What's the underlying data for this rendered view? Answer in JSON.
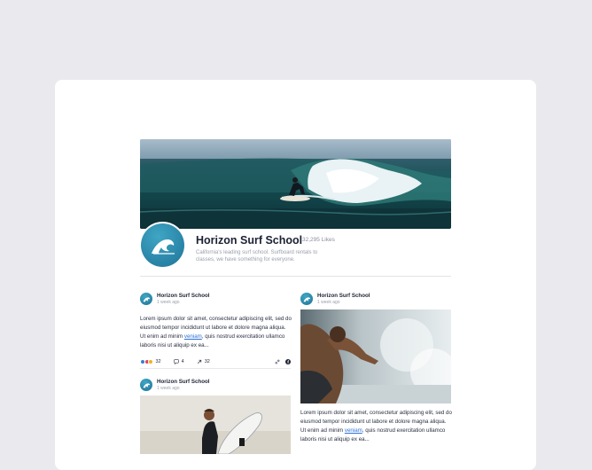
{
  "page": {
    "name": "Horizon Surf School",
    "likes": "32,295 Likes",
    "description": "California's leading surf school. Surfboard rentals to classes, we have something for everyone."
  },
  "posts": [
    {
      "author": "Horizon Surf School",
      "time": "1 week ago",
      "text_before": "Lorem ipsum dolor sit amet, consectetur adipiscing elit, sed do eiusmod tempor incididunt ut labore et dolore magna aliqua. Ut enim ad minim ",
      "link": "veniam",
      "text_after": ", quis nostrud exercitation ullamco laboris nisi ut aliquip ex ea...",
      "reactions": "32",
      "comments": "4",
      "shares": "32"
    },
    {
      "author": "Horizon Surf School",
      "time": "1 week ago"
    },
    {
      "author": "Horizon Surf School",
      "time": "1 week ago",
      "text_before": "Lorem ipsum dolor sit amet, consectetur adipiscing elit, sed do eiusmod tempor incididunt ut labore et dolore magna aliqua. Ut enim ad minim ",
      "link": "veniam",
      "text_after": ", quis nostrud exercitation ullamco laboris nisi ut aliquip ex ea..."
    }
  ],
  "colors": {
    "brand": "#2a8fb3",
    "link": "#2a6fdb"
  },
  "icons": [
    "wave-logo-icon",
    "like-reaction-icon",
    "love-reaction-icon",
    "haha-reaction-icon",
    "comment-icon",
    "share-icon",
    "link-icon",
    "facebook-icon"
  ]
}
